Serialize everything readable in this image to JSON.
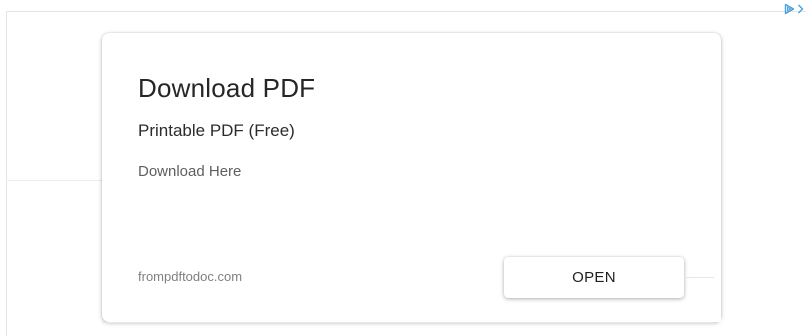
{
  "ad": {
    "title": "Download PDF",
    "subtitle": "Printable PDF (Free)",
    "description": "Download Here",
    "display_url": "frompdftodoc.com",
    "cta_label": "OPEN"
  },
  "ad_choices": {
    "icons": [
      "adchoices-play-icon",
      "chevron-right-icon"
    ],
    "accent_color": "#4a9fe0"
  },
  "colors": {
    "background": "#ffffff",
    "title": "#262626",
    "muted_text": "#808080"
  }
}
